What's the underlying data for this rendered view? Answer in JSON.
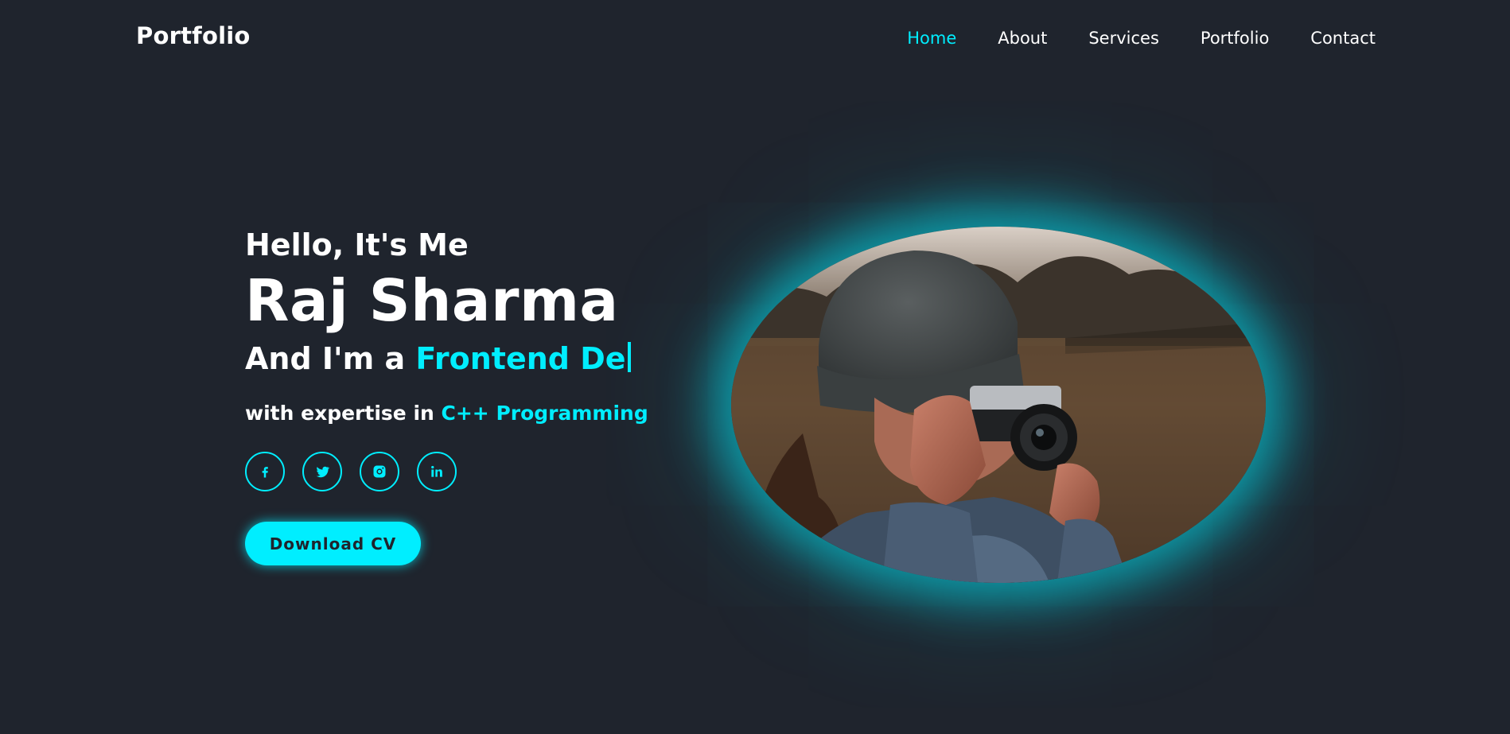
{
  "header": {
    "logo": "Portfolio",
    "nav": [
      {
        "label": "Home",
        "active": true
      },
      {
        "label": "About",
        "active": false
      },
      {
        "label": "Services",
        "active": false
      },
      {
        "label": "Portfolio",
        "active": false
      },
      {
        "label": "Contact",
        "active": false
      }
    ]
  },
  "hero": {
    "greeting": "Hello, It's Me",
    "name": "Raj Sharma",
    "role_prefix": "And I'm a ",
    "role_typed": "Frontend De",
    "expertise_prefix": "with expertise in ",
    "expertise_highlight": "C++ Programming",
    "socials": [
      {
        "icon": "facebook-icon"
      },
      {
        "icon": "twitter-icon"
      },
      {
        "icon": "instagram-icon"
      },
      {
        "icon": "linkedin-icon"
      }
    ],
    "cv_button": "Download CV",
    "photo": {
      "icon": "photographer-photo"
    }
  },
  "colors": {
    "background": "#1f242d",
    "accent": "#00eeff",
    "text": "#ffffff"
  }
}
